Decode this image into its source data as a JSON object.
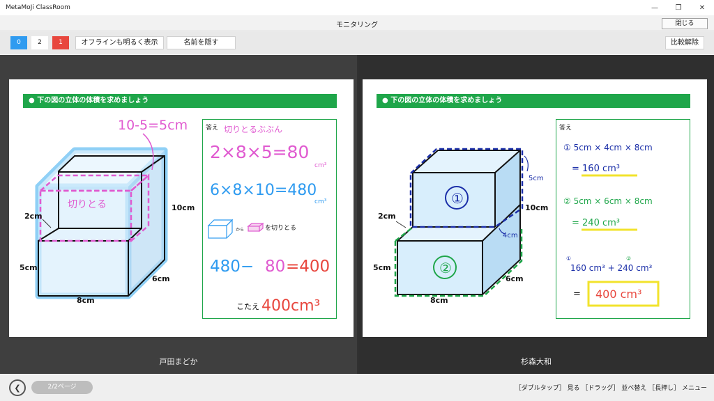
{
  "window": {
    "app_title": "MetaMoJi ClassRoom"
  },
  "header": {
    "title": "モニタリング",
    "close_label": "閉じる"
  },
  "toolbar": {
    "counts": [
      "0",
      "2",
      "1"
    ],
    "show_offline_label": "オフラインも明るく表示",
    "hide_names_label": "名前を隠す",
    "compare_off_label": "比較解除"
  },
  "problem": {
    "title": "下の図の立体の体積を求めましょう",
    "answer_label": "答え"
  },
  "figure_labels": {
    "height": "10cm",
    "upper": "2cm",
    "lower": "5cm",
    "depth": "6cm",
    "width": "8cm"
  },
  "panels": [
    {
      "student": "戸田まどか",
      "handwriting": {
        "top_note": "10-5=5cm",
        "cut_label": "切りとる",
        "cut_part": "切りとるぶぶん",
        "eq1": "2×8×5=80",
        "eq1_unit": "cm³",
        "eq2": "6×8×10=480",
        "eq2_unit": "cm³",
        "from": "から",
        "cut_action": "を切りとる",
        "eq3a": "480−",
        "eq3b": "80",
        "eq3c": "=400",
        "answer_prefix": "こたえ",
        "answer": "400cm³"
      }
    },
    {
      "student": "杉森大和",
      "handwriting": {
        "part1": "①",
        "part2": "②",
        "side_note": "5cm",
        "side_note2": "4cm",
        "line1": "①  5cm × 4cm × 8cm",
        "line1_result": "= 160 cm³",
        "line2": "②  5cm × 6cm × 8cm",
        "line2_result": "= 240 cm³",
        "sum_mark1": "①",
        "sum_mark2": "②",
        "sum": "160 cm³  +  240 cm³",
        "equals": "=",
        "answer": "400 cm³"
      }
    }
  ],
  "footer": {
    "page": "2/2ページ",
    "hints": "［ダブルタップ］ 見る ［ドラッグ］ 並べ替え ［長押し］ メニュー"
  },
  "colors": {
    "blue": "#2f9bf0",
    "red": "#e8473e",
    "green": "#1fa64a",
    "magenta": "#e05ad0",
    "navy": "#1a2ea8"
  }
}
